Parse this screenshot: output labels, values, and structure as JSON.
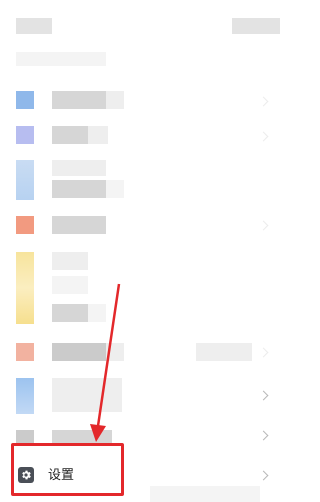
{
  "menu": {
    "settings_label": "设置"
  },
  "icons": {
    "settings": "gear-icon",
    "chevron": "chevron-right-icon"
  },
  "colors": {
    "highlight": "#e3282b",
    "arrow": "#e3282b",
    "icon_blue": "#8fb8ea",
    "icon_purple": "#b7bdf0",
    "icon_orange": "#f29a80",
    "icon_yellow": "#f7e49c"
  }
}
